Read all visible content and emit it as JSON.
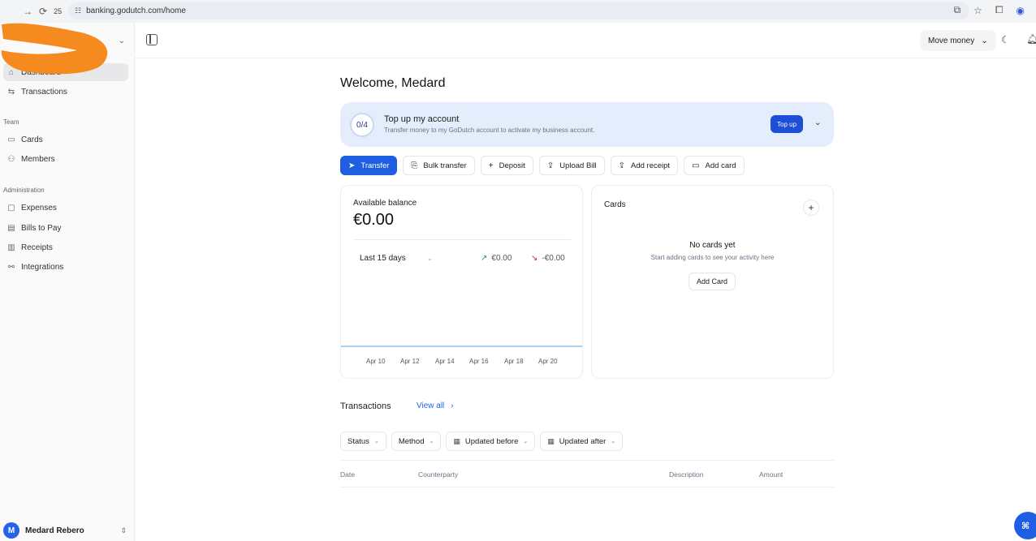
{
  "browser": {
    "tab_count": "25",
    "url": "banking.godutch.com/home"
  },
  "sidebar": {
    "items_top": [
      {
        "label": "Dashboard"
      },
      {
        "label": "Transactions"
      }
    ],
    "team_label": "Team",
    "team_items": [
      {
        "label": "Cards"
      },
      {
        "label": "Members"
      }
    ],
    "admin_label": "Administration",
    "admin_items": [
      {
        "label": "Expenses"
      },
      {
        "label": "Bills to Pay"
      },
      {
        "label": "Receipts"
      },
      {
        "label": "Integrations"
      }
    ],
    "user": {
      "initial": "M",
      "name": "Medard Rebero"
    }
  },
  "header": {
    "move_money_label": "Move money"
  },
  "main": {
    "welcome": "Welcome, Medard",
    "topup": {
      "progress": "0/4",
      "title": "Top up my account",
      "subtitle": "Transfer money to my GoDutch account to activate my business account.",
      "button_label": "Top up"
    },
    "actions": [
      {
        "label": "Transfer"
      },
      {
        "label": "Bulk transfer"
      },
      {
        "label": "Deposit"
      },
      {
        "label": "Upload Bill"
      },
      {
        "label": "Add receipt"
      },
      {
        "label": "Add card"
      }
    ],
    "balance": {
      "label": "Available balance",
      "value": "€0.00",
      "period": "Last 15 days",
      "inflow": "€0.00",
      "outflow": "-€0.00",
      "x_ticks": [
        "Apr 10",
        "Apr 12",
        "Apr 14",
        "Apr 16",
        "Apr 18",
        "Apr 20"
      ]
    },
    "cards": {
      "title": "Cards",
      "empty_title": "No cards yet",
      "empty_subtitle": "Start adding cards to see your activity here",
      "add_button": "Add Card"
    },
    "transactions": {
      "title": "Transactions",
      "view_all": "View all",
      "filters": [
        {
          "label": "Status"
        },
        {
          "label": "Method"
        },
        {
          "label": "Updated before"
        },
        {
          "label": "Updated after"
        }
      ],
      "columns": [
        "Date",
        "Counterparty",
        "Description",
        "Amount"
      ]
    }
  },
  "colors": {
    "primary": "#1d5fe0",
    "topup_bg": "#e4edfb",
    "scribble": "#f58a1f"
  }
}
